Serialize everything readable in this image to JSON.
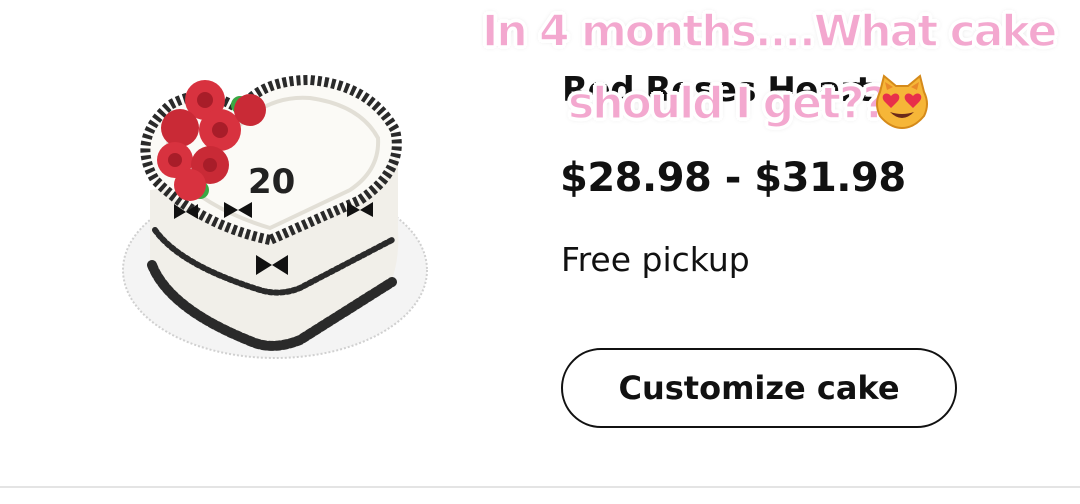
{
  "product": {
    "title_partial": "Red Roses Heart",
    "price": "$28.98 - $31.98",
    "pickup": "Free pickup",
    "cake_number": "20",
    "customize_label": "Customize cake"
  },
  "overlay": {
    "caption_line1": "In 4 months....What cake",
    "caption_line2": "should I get??",
    "emoji": "heart-eyes-cat-emoji"
  },
  "colors": {
    "caption_pink": "#f3a8cf",
    "text": "#111111",
    "rose_red": "#d8323f",
    "leaf_green": "#3aa845"
  }
}
